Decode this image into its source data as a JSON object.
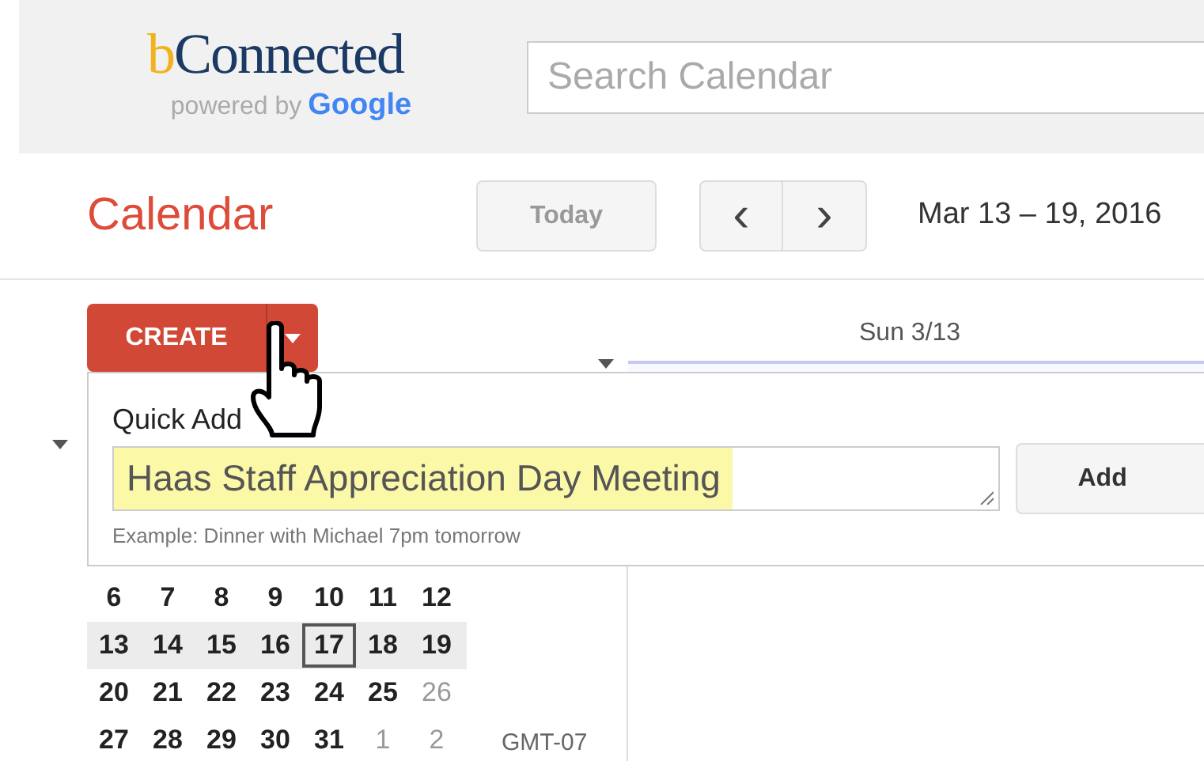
{
  "header": {
    "logo": {
      "accent": "b",
      "name": "Connected",
      "powered_by": "powered by",
      "google": "Google"
    },
    "search": {
      "placeholder": "Search Calendar"
    }
  },
  "toolbar": {
    "title": "Calendar",
    "today": "Today",
    "prev": "‹",
    "next": "›",
    "date_range": "Mar 13 – 19, 2016"
  },
  "create_button": "CREATE",
  "day_header": "Sun 3/13",
  "quick_add": {
    "label": "Quick Add",
    "value": "Haas Staff Appreciation Day Meeting",
    "highlighted": true,
    "add_button": "Add",
    "example": "Example: Dinner with Michael 7pm tomorrow"
  },
  "mini_calendar": {
    "weeks": [
      {
        "highlighted": false,
        "days": [
          {
            "label": "6",
            "muted": false,
            "today": false
          },
          {
            "label": "7",
            "muted": false,
            "today": false
          },
          {
            "label": "8",
            "muted": false,
            "today": false
          },
          {
            "label": "9",
            "muted": false,
            "today": false
          },
          {
            "label": "10",
            "muted": false,
            "today": false
          },
          {
            "label": "11",
            "muted": false,
            "today": false
          },
          {
            "label": "12",
            "muted": false,
            "today": false
          }
        ]
      },
      {
        "highlighted": true,
        "days": [
          {
            "label": "13",
            "muted": false,
            "today": false
          },
          {
            "label": "14",
            "muted": false,
            "today": false
          },
          {
            "label": "15",
            "muted": false,
            "today": false
          },
          {
            "label": "16",
            "muted": false,
            "today": false
          },
          {
            "label": "17",
            "muted": false,
            "today": true
          },
          {
            "label": "18",
            "muted": false,
            "today": false
          },
          {
            "label": "19",
            "muted": false,
            "today": false
          }
        ]
      },
      {
        "highlighted": false,
        "days": [
          {
            "label": "20",
            "muted": false,
            "today": false
          },
          {
            "label": "21",
            "muted": false,
            "today": false
          },
          {
            "label": "22",
            "muted": false,
            "today": false
          },
          {
            "label": "23",
            "muted": false,
            "today": false
          },
          {
            "label": "24",
            "muted": false,
            "today": false
          },
          {
            "label": "25",
            "muted": false,
            "today": false
          },
          {
            "label": "26",
            "muted": true,
            "today": false
          }
        ]
      },
      {
        "highlighted": false,
        "days": [
          {
            "label": "27",
            "muted": false,
            "today": false
          },
          {
            "label": "28",
            "muted": false,
            "today": false
          },
          {
            "label": "29",
            "muted": false,
            "today": false
          },
          {
            "label": "30",
            "muted": false,
            "today": false
          },
          {
            "label": "31",
            "muted": false,
            "today": false
          },
          {
            "label": "1",
            "muted": true,
            "today": false
          },
          {
            "label": "2",
            "muted": true,
            "today": false
          }
        ]
      }
    ]
  },
  "timezone": "GMT-07"
}
